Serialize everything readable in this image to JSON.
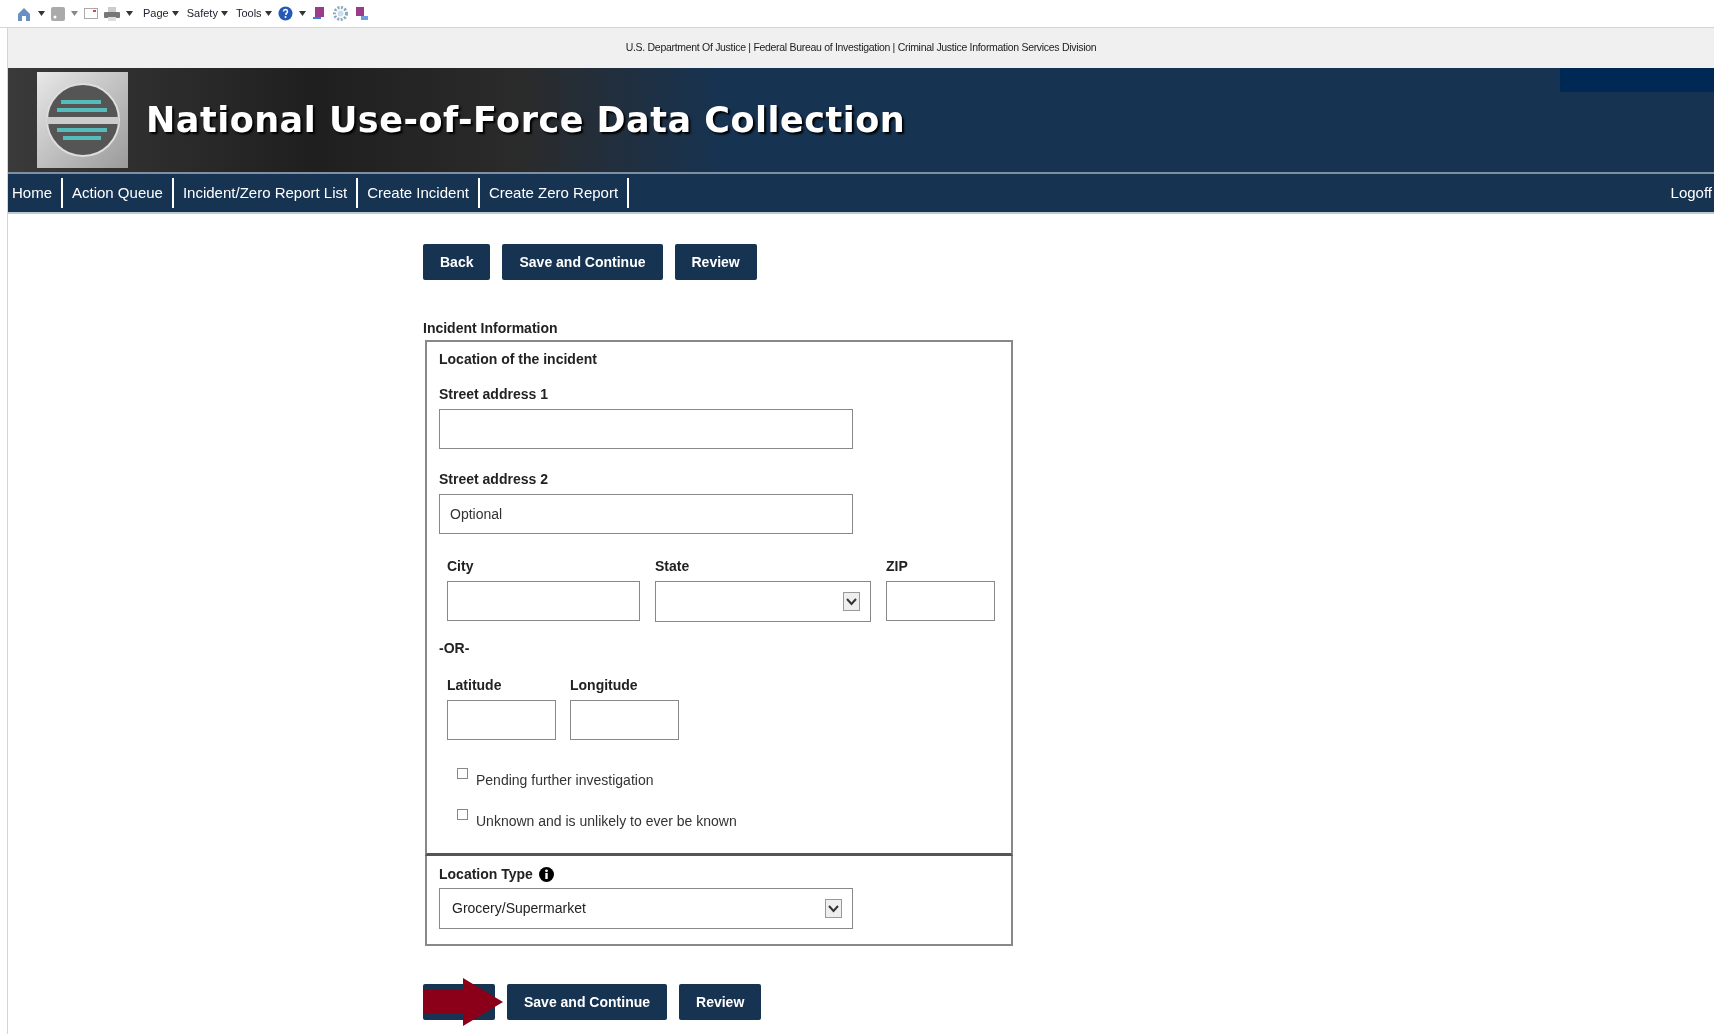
{
  "toolbar": {
    "menus": [
      "Page",
      "Safety",
      "Tools"
    ]
  },
  "agency_line": "U.S. Department Of Justice | Federal Bureau of Investigation | Criminal Justice Information Services Division",
  "header": {
    "title": "National Use-of-Force Data Collection"
  },
  "nav": {
    "items": [
      {
        "label": "Home"
      },
      {
        "label": "Action Queue"
      },
      {
        "label": "Incident/Zero Report List"
      },
      {
        "label": "Create Incident"
      },
      {
        "label": "Create Zero Report"
      }
    ],
    "logoff": "Logoff"
  },
  "top_buttons": [
    "Back",
    "Save and Continue",
    "Review"
  ],
  "section_title": "Incident Information",
  "location": {
    "heading": "Location of the incident",
    "street1": {
      "label": "Street address 1"
    },
    "street2": {
      "label": "Street address 2",
      "placeholder": "Optional"
    },
    "city": {
      "label": "City"
    },
    "state": {
      "label": "State"
    },
    "zip": {
      "label": "ZIP"
    },
    "or_text": "-OR-",
    "latitude": {
      "label": "Latitude"
    },
    "longitude": {
      "label": "Longitude"
    },
    "checkboxes": [
      {
        "label": "Pending further investigation",
        "checked": false
      },
      {
        "label": "Unknown and is unlikely to ever be known",
        "checked": false
      }
    ]
  },
  "location_type": {
    "label": "Location Type",
    "value": "Grocery/Supermarket"
  },
  "bottom_buttons": [
    "Save and Continue",
    "Review"
  ]
}
